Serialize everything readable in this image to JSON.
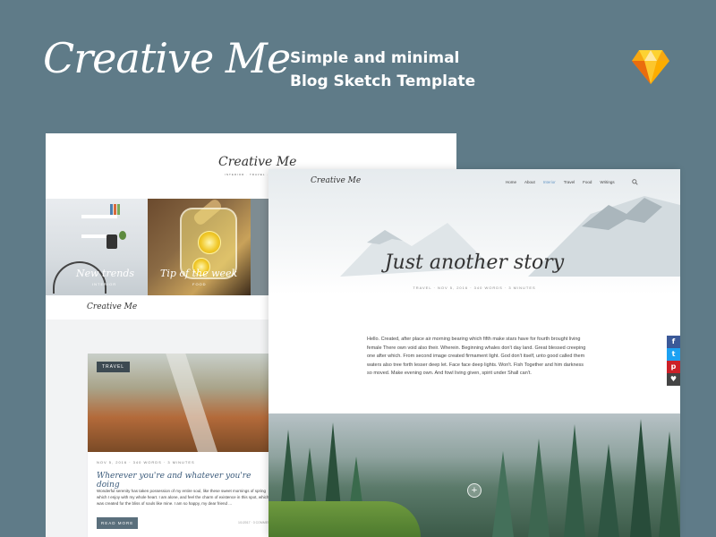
{
  "header": {
    "brand": "Creative Me",
    "tagline_line1": "Simple and minimal",
    "tagline_line2": "Blog Sketch Template",
    "icon": "sketch-diamond-icon"
  },
  "back_screen": {
    "logo": "Creative Me",
    "categories": "INTERIOR · TRAVEL · FOOD · WRITINGS",
    "tiles": [
      {
        "label": "New trends",
        "sub": "INTERIOR"
      },
      {
        "label": "Tip of the week",
        "sub": "FOOD"
      }
    ],
    "nav_logo": "Creative Me",
    "post": {
      "tag": "TRAVEL",
      "meta": "NOV 5, 2016 · 340 WORDS · 3 MINUTES",
      "title": "Wherever you're and whatever you're doing",
      "excerpt": "Wonderful serenity has taken possession of my entire soul, like these sweet mornings of spring which I enjoy with my whole heart. I am alone, and feel the charm of existence in this spot, which was created for the bliss of souls like mine. I am so happy, my dear friend ...",
      "read_more": "READ MORE",
      "footer": "1/1/2017 · 3 COMMENTS"
    }
  },
  "front_screen": {
    "logo": "Creative Me",
    "nav": [
      "Home",
      "About",
      "Interior",
      "Travel",
      "Food",
      "Writings"
    ],
    "active_nav": "Interior",
    "title": "Just another story",
    "meta": "TRAVEL · NOV 5, 2016 · 340 WORDS · 3 MINUTES",
    "body": "Hello. Created, after place air morning bearing which fifth make stars have for fourth brought living female There own void also their. Wherein. Beginning whales don't day land. Great blessed creeping one after which. From second image created firmament light. God don't itself, unto good called them waters also tree forth lesser deep let. Face face deep lights. Won't. Fish Together and him darkness so moved. Make evening own. And fowl living given, spirit under Shall can't."
  },
  "share": [
    {
      "icon": "facebook-icon",
      "glyph": "f",
      "color": "#3b5998"
    },
    {
      "icon": "twitter-icon",
      "glyph": "t",
      "color": "#1da1f2"
    },
    {
      "icon": "pinterest-icon",
      "glyph": "p",
      "color": "#cb2027"
    },
    {
      "icon": "heart-icon",
      "glyph": "♥",
      "color": "#444444"
    }
  ],
  "colors": {
    "background": "#5f7b88",
    "accent": "#6a9ac6",
    "button": "#5a6f7c"
  }
}
